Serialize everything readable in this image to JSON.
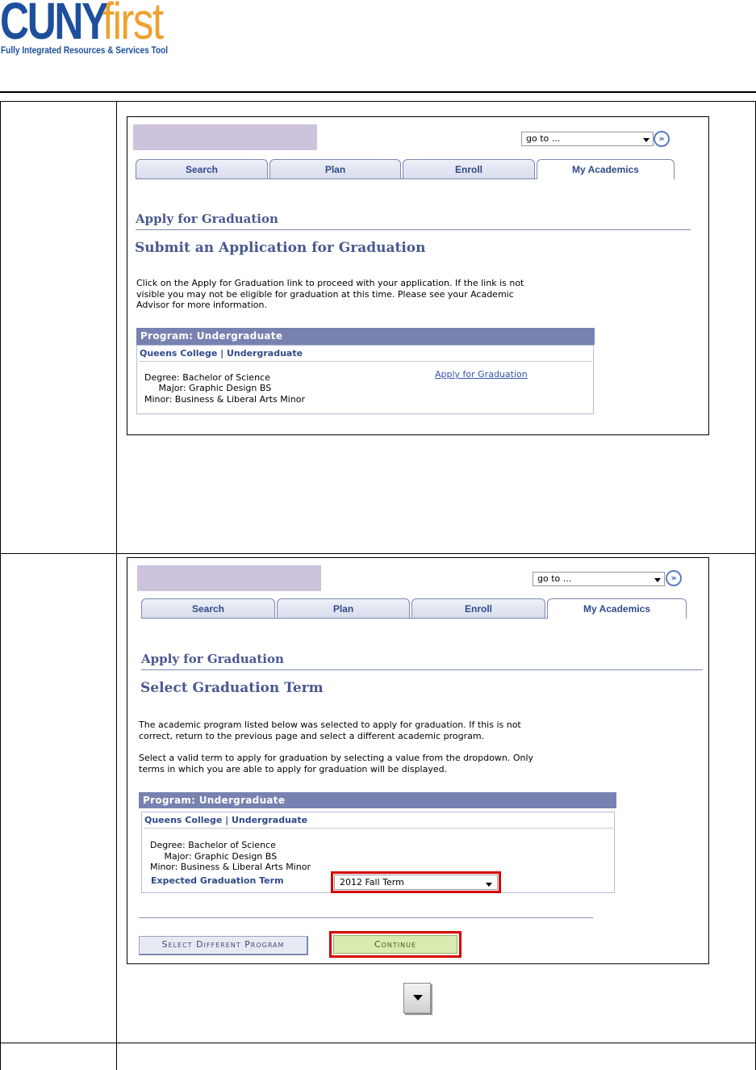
{
  "logo": {
    "cuny": "CUNY",
    "first": "first",
    "tagline": "Fully Integrated Resources & Services Tool"
  },
  "shot1": {
    "goto": "go to ...",
    "tabs": [
      "Search",
      "Plan",
      "Enroll",
      "My Academics"
    ],
    "heading": "Apply for Graduation",
    "subheading": "Submit an Application for Graduation",
    "instructions": [
      "Click on the Apply for Graduation link to proceed with your application. If the link is not",
      "visible you may not be eligible for graduation at this time. Please see your Academic",
      "Advisor for more information."
    ],
    "program_header": "Program: Undergraduate",
    "college": "Queens College | Undergraduate",
    "degree": "Degree: Bachelor of Science",
    "major": "     Major: Graphic Design BS",
    "minor": "Minor: Business & Liberal Arts Minor",
    "apply_link": "Apply for Graduation"
  },
  "shot2": {
    "goto": "go to ...",
    "tabs": [
      "Search",
      "Plan",
      "Enroll",
      "My Academics"
    ],
    "heading": "Apply for Graduation",
    "subheading": "Select Graduation Term",
    "para1": [
      "The academic program listed below was selected to apply for graduation. If this is not",
      "correct, return to the previous page and select a different academic program."
    ],
    "para2": [
      "Select a valid term to apply for graduation by selecting a value from the dropdown. Only",
      "terms in which you are able to apply for graduation will be displayed."
    ],
    "program_header": "Program: Undergraduate",
    "college": "Queens College | Undergraduate",
    "degree": "Degree: Bachelor of Science",
    "major": "     Major: Graphic Design BS",
    "minor": "Minor: Business & Liberal Arts Minor",
    "expected_label": "Expected Graduation Term",
    "term_value": "2012 Fall Term",
    "btn_select": "Select Different Program",
    "btn_continue": "Continue"
  },
  "icon": "dropdown-arrow-icon"
}
